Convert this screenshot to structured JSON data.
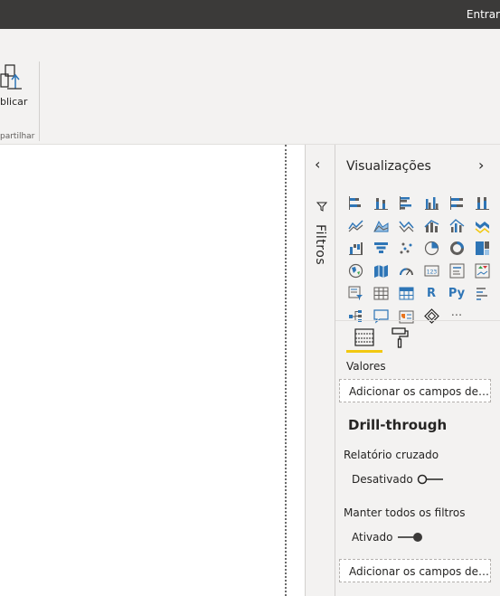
{
  "titlebar": {
    "signin": "Entrar"
  },
  "ribbon": {
    "publish_label": "blicar",
    "group_label": "partilhar"
  },
  "filters": {
    "title": "Filtros",
    "collapse_icon": "chevron-left-icon"
  },
  "visualizations": {
    "title": "Visualizações",
    "expand_icon": "chevron-right-icon",
    "text_icons": {
      "r": "R",
      "py": "Py",
      "more": "···"
    },
    "tab_fields_icon": "fields-icon",
    "tab_format_icon": "paint-roller-icon",
    "values_label": "Valores",
    "values_placeholder": "Adicionar os campos de da...",
    "drillthrough": {
      "title": "Drill-through",
      "cross_report_label": "Relatório cruzado",
      "cross_report_state": "Desativado",
      "keep_filters_label": "Manter todos os filtros",
      "keep_filters_state": "Ativado",
      "fields_placeholder": "Adicionar os campos de dr..."
    }
  },
  "colors": {
    "accent": "#f2c811",
    "icon_blue": "#2e75b6",
    "titlebar": "#3b3a39"
  }
}
